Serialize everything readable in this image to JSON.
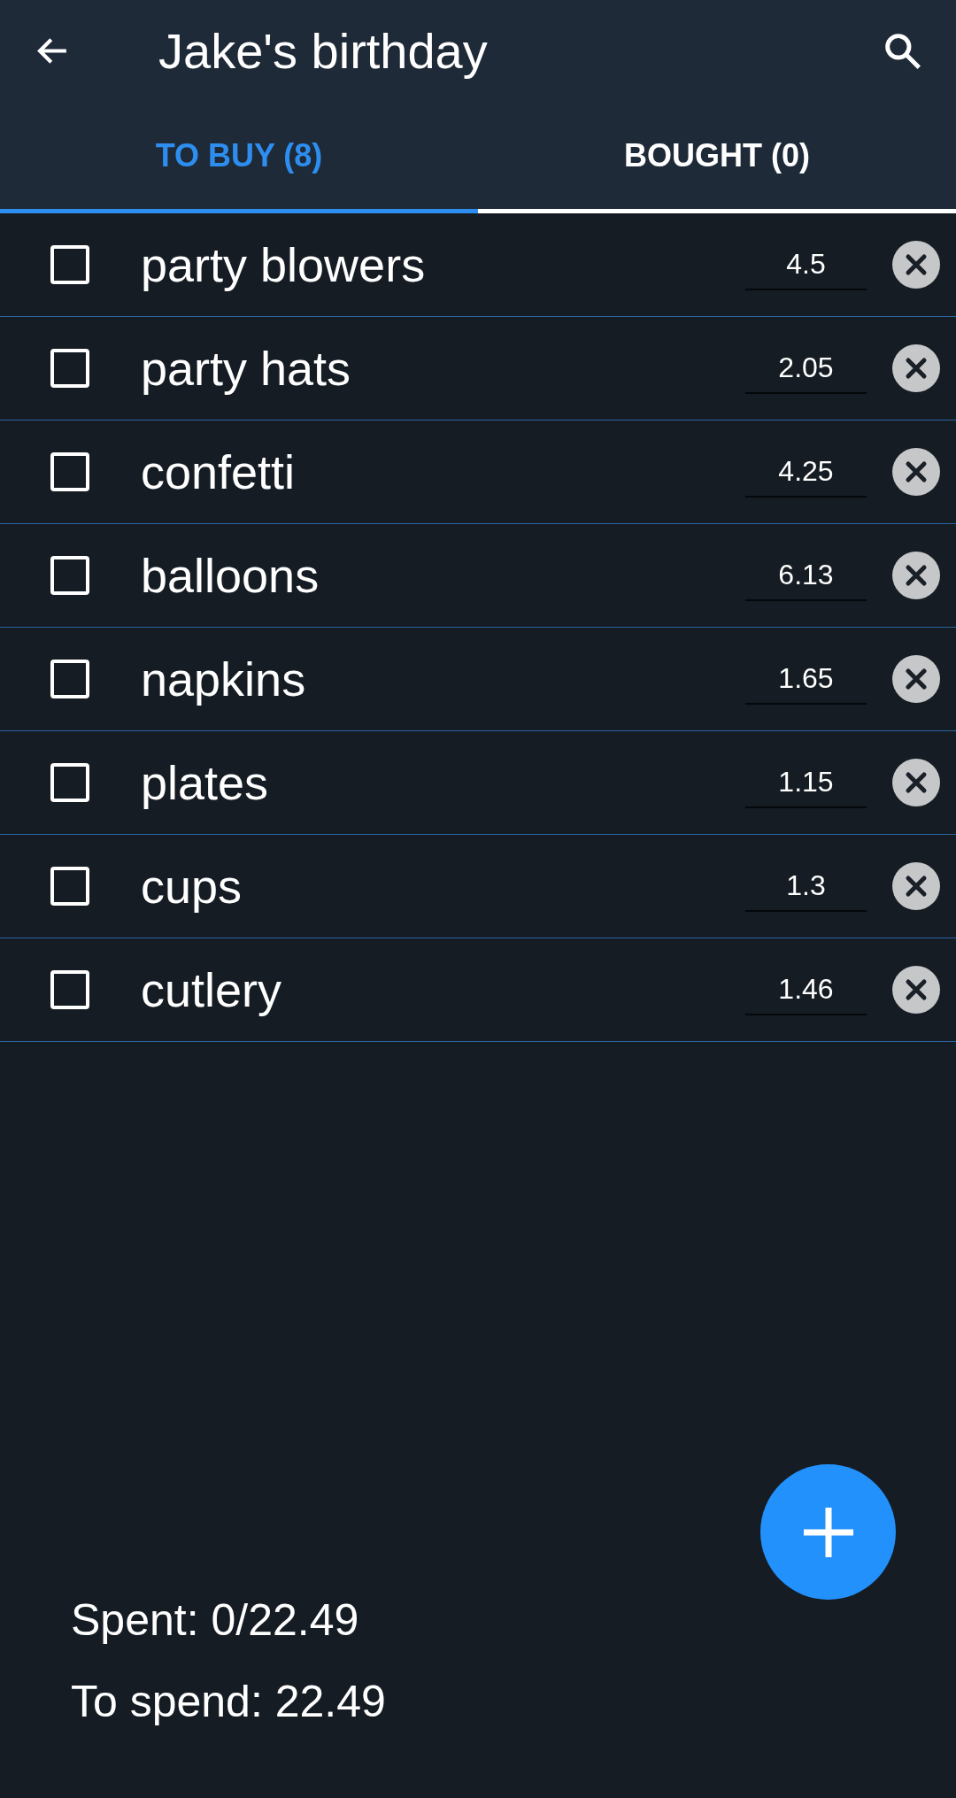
{
  "app_bar": {
    "title": "Jake's birthday"
  },
  "tabs": [
    {
      "label": "TO BUY (8)",
      "selected": true
    },
    {
      "label": "BOUGHT (0)",
      "selected": false
    }
  ],
  "items": [
    {
      "name": "party blowers",
      "price": "4.5",
      "checked": false
    },
    {
      "name": "party hats",
      "price": "2.05",
      "checked": false
    },
    {
      "name": "confetti",
      "price": "4.25",
      "checked": false
    },
    {
      "name": "balloons",
      "price": "6.13",
      "checked": false
    },
    {
      "name": "napkins",
      "price": "1.65",
      "checked": false
    },
    {
      "name": "plates",
      "price": "1.15",
      "checked": false
    },
    {
      "name": "cups",
      "price": "1.3",
      "checked": false
    },
    {
      "name": "cutlery",
      "price": "1.46",
      "checked": false
    }
  ],
  "totals": {
    "spent": "Spent: 0/22.49",
    "to_spend": "To spend: 22.49"
  }
}
